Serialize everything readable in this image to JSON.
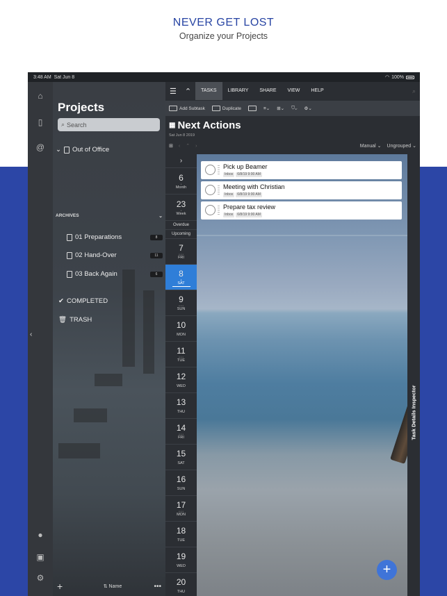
{
  "hero": {
    "title": "NEVER GET LOST",
    "subtitle": "Organize your Projects"
  },
  "statusbar": {
    "time": "3:48 AM",
    "date": "Sat Jun 8",
    "battery": "100%"
  },
  "rail": {
    "icons": [
      "inbox-icon",
      "documents-icon",
      "at-icon",
      "account-icon",
      "database-icon",
      "settings-icon"
    ]
  },
  "sidebar": {
    "title": "Projects",
    "search_placeholder": "Search",
    "folder": {
      "label": "Out of Office"
    },
    "projects": [
      {
        "label": "01 Preparations",
        "count": "8"
      },
      {
        "label": "02 Hand-Over",
        "count": "11"
      },
      {
        "label": "03 Back Again",
        "count": "6"
      }
    ],
    "archives_header": "ARCHIVES",
    "completed": "COMPLETED",
    "trash": "TRASH",
    "bottom": {
      "add": "+",
      "sort": "⇅ Name",
      "more": "•••"
    }
  },
  "menubar": {
    "items": [
      "TASKS",
      "LIBRARY",
      "SHARE",
      "VIEW",
      "HELP"
    ],
    "active": "TASKS"
  },
  "toolbar": {
    "add_subtask": "Add Subtask",
    "duplicate": "Duplicate"
  },
  "header": {
    "title": "Next Actions",
    "date": "Sat Jun 8 2019",
    "sort": "Manual",
    "group": "Ungrouped"
  },
  "strip": {
    "cells": [
      {
        "num": "",
        "lbl": "›"
      },
      {
        "num": "6",
        "lbl": "Month"
      },
      {
        "num": "23",
        "lbl": "Week"
      },
      {
        "num": "",
        "lbl": "Overdue"
      },
      {
        "num": "",
        "lbl": "Upcoming"
      },
      {
        "num": "7",
        "lbl": "FRI"
      },
      {
        "num": "8",
        "lbl": "SAT"
      },
      {
        "num": "9",
        "lbl": "SUN"
      },
      {
        "num": "10",
        "lbl": "MON"
      },
      {
        "num": "11",
        "lbl": "TUE"
      },
      {
        "num": "12",
        "lbl": "WED"
      },
      {
        "num": "13",
        "lbl": "THU"
      },
      {
        "num": "14",
        "lbl": "FRI"
      },
      {
        "num": "15",
        "lbl": "SAT"
      },
      {
        "num": "16",
        "lbl": "SUN"
      },
      {
        "num": "17",
        "lbl": "MON"
      },
      {
        "num": "18",
        "lbl": "TUE"
      },
      {
        "num": "19",
        "lbl": "WED"
      },
      {
        "num": "20",
        "lbl": "THU"
      }
    ]
  },
  "tasks": [
    {
      "name": "Pick up Beamer",
      "list": "Inbox",
      "due": "6/8/19 9:00 AM"
    },
    {
      "name": "Meeting with Christian",
      "list": "Inbox",
      "due": "6/8/19 9:00 AM"
    },
    {
      "name": "Prepare tax review",
      "list": "Inbox",
      "due": "6/8/19 9:00 AM"
    }
  ],
  "inspector": {
    "label": "Task Details Inspector"
  },
  "fab": {
    "label": "+"
  },
  "colors": {
    "accent": "#2f7ed8",
    "band": "#2c46a6",
    "fab": "#3f74d8"
  }
}
